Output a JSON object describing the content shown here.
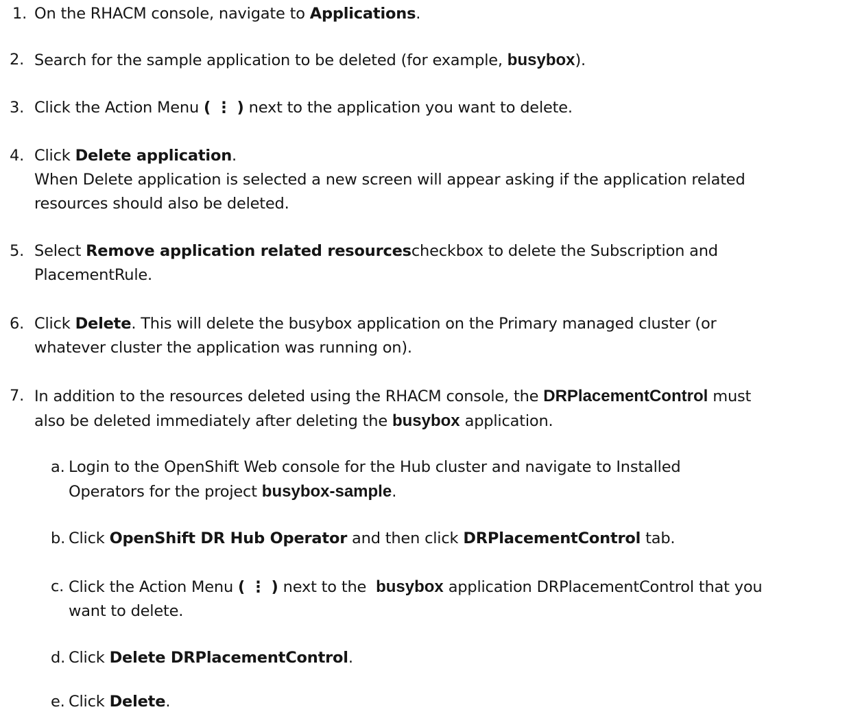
{
  "steps": [
    {
      "marker": "1.",
      "p1": "On the RHACM console, navigate to ",
      "b1": "Applications",
      "p2": "."
    },
    {
      "marker": "2.",
      "p1": "Search for the sample application to be deleted (for example, ",
      "b1": "busybox",
      "p2": ")."
    },
    {
      "marker": "3.",
      "p1": "Click the Action Menu ",
      "b1": "( ⋮ )",
      "p2": " next to the application you want to delete."
    },
    {
      "marker": "4.",
      "p1": "Click ",
      "b1": "Delete application",
      "p2": ".",
      "l2": "When Delete application is selected a new screen will appear asking if the application related",
      "l3": "resources should also be deleted."
    },
    {
      "marker": "5.",
      "p1": "Select ",
      "b1": "Remove application related resources",
      "p2": "checkbox to delete the Subscription and",
      "l2": "PlacementRule."
    },
    {
      "marker": "6.",
      "p1": "Click ",
      "b1": "Delete",
      "p2": ". This will delete the busybox application on the Primary managed cluster (or",
      "l2": "whatever cluster the application was running on)."
    },
    {
      "marker": "7.",
      "p1": "In addition to the resources deleted using the RHACM console, the ",
      "b1": "DRPlacementControl",
      "p2": " must",
      "l2a": "also be deleted immediately after deleting the ",
      "l2b": "busybox",
      "l2c": " application."
    }
  ],
  "substeps": [
    {
      "marker": "a.",
      "l1": "Login to the OpenShift Web console for the Hub cluster and navigate to Installed",
      "l2a": "Operators for the project ",
      "l2b": "busybox-sample",
      "l2c": "."
    },
    {
      "marker": "b.",
      "p1": "Click ",
      "b1": "OpenShift DR Hub Operator",
      "p2": " and then click ",
      "b2": "DRPlacementControl",
      "p3": " tab."
    },
    {
      "marker": "c.",
      "p1": "Click the Action Menu ",
      "b1": "( ⋮ )",
      "p2": " next to the  ",
      "b2": "busybox",
      "p3": " application DRPlacementControl that you",
      "l2": "want to delete."
    },
    {
      "marker": "d.",
      "p1": "Click ",
      "b1": "Delete DRPlacementControl",
      "p2": "."
    },
    {
      "marker": "e.",
      "p1": "Click ",
      "b1": "Delete",
      "p2": "."
    }
  ]
}
